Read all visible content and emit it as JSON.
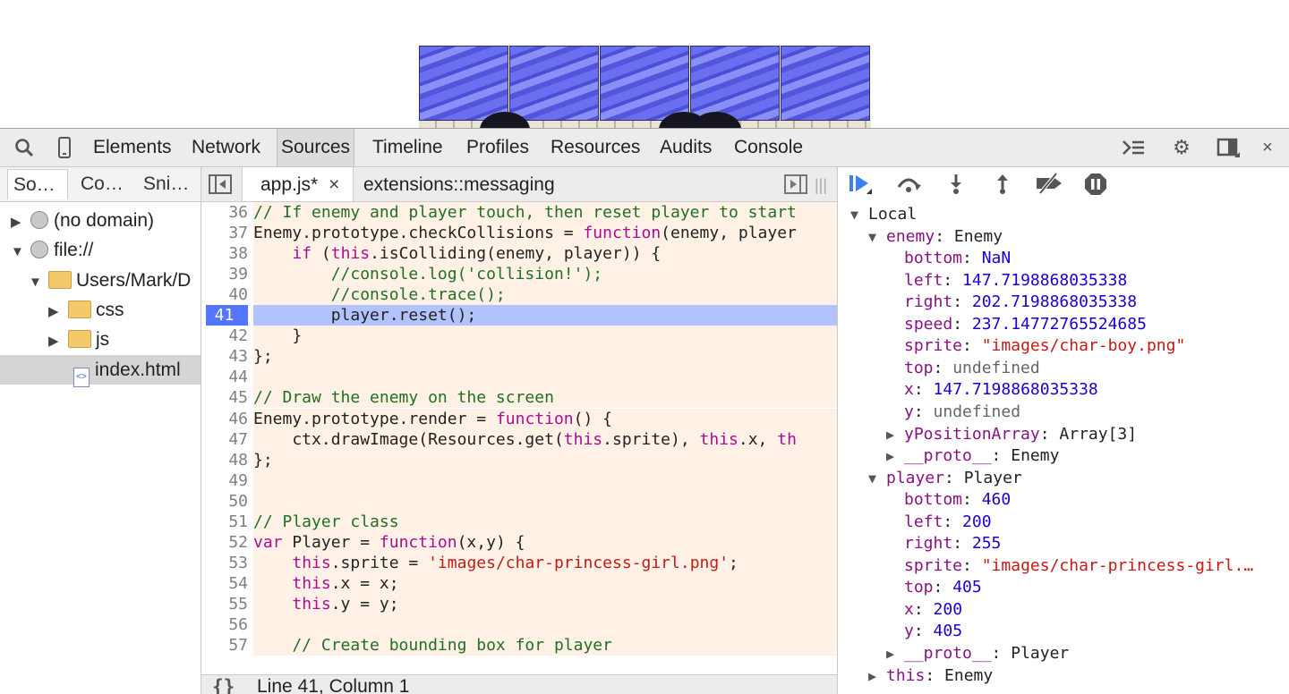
{
  "devtools": {
    "tabs": [
      "Elements",
      "Network",
      "Sources",
      "Timeline",
      "Profiles",
      "Resources",
      "Audits",
      "Console"
    ],
    "active_tab": "Sources",
    "close_glyph": "×"
  },
  "navigator": {
    "tabs": [
      "So…",
      "Co…",
      "Sni…"
    ],
    "tree": [
      {
        "label": "(no domain)",
        "icon": "globe-icon",
        "arrow": "▶"
      },
      {
        "label": "file://",
        "icon": "globe-icon",
        "arrow": "▼"
      },
      {
        "label": "Users/Mark/D",
        "icon": "folder-icon",
        "arrow": "▼"
      },
      {
        "label": "css",
        "icon": "folder-icon",
        "arrow": "▶"
      },
      {
        "label": "js",
        "icon": "folder-icon",
        "arrow": "▶"
      },
      {
        "label": "index.html",
        "icon": "html-file-icon",
        "arrow": ""
      }
    ]
  },
  "editor": {
    "tabs": [
      {
        "label": "app.js*",
        "close": "×"
      },
      {
        "label": "extensions::messaging"
      }
    ],
    "current_line": 41,
    "status": "Line 41, Column 1",
    "format_button": "{}",
    "lines": [
      {
        "n": "36",
        "t": [
          [
            "comment",
            "// If enemy and player touch, then reset player to start"
          ]
        ]
      },
      {
        "n": "37",
        "t": [
          [
            "",
            "Enemy.prototype.checkCollisions = "
          ],
          [
            "kw",
            "function"
          ],
          [
            "",
            "(enemy, player"
          ]
        ]
      },
      {
        "n": "38",
        "t": [
          [
            "",
            "    "
          ],
          [
            "kw",
            "if"
          ],
          [
            "",
            " ("
          ],
          [
            "kw",
            "this"
          ],
          [
            "",
            ".isColliding(enemy, player)) {"
          ]
        ]
      },
      {
        "n": "39",
        "t": [
          [
            "comment",
            "        //console.log('collision!');"
          ]
        ]
      },
      {
        "n": "40",
        "t": [
          [
            "comment",
            "        //console.trace();"
          ]
        ]
      },
      {
        "n": "41",
        "t": [
          [
            "",
            "        player.reset();"
          ]
        ]
      },
      {
        "n": "42",
        "t": [
          [
            "",
            "    }"
          ]
        ]
      },
      {
        "n": "43",
        "t": [
          [
            "",
            "};"
          ]
        ]
      },
      {
        "n": "44",
        "t": [
          [
            "",
            ""
          ]
        ]
      },
      {
        "n": "45",
        "t": [
          [
            "comment",
            "// Draw the enemy on the screen"
          ]
        ]
      },
      {
        "n": "46",
        "t": [
          [
            "",
            "Enemy.prototype.render = "
          ],
          [
            "kw",
            "function"
          ],
          [
            "",
            "() {"
          ]
        ]
      },
      {
        "n": "47",
        "t": [
          [
            "",
            "    ctx.drawImage(Resources.get("
          ],
          [
            "kw",
            "this"
          ],
          [
            "",
            ".sprite), "
          ],
          [
            "kw",
            "this"
          ],
          [
            "",
            ".x, "
          ],
          [
            "kw",
            "th"
          ]
        ]
      },
      {
        "n": "48",
        "t": [
          [
            "",
            "};"
          ]
        ]
      },
      {
        "n": "49",
        "t": [
          [
            "",
            ""
          ]
        ]
      },
      {
        "n": "50",
        "t": [
          [
            "",
            ""
          ]
        ]
      },
      {
        "n": "51",
        "t": [
          [
            "comment",
            "// Player class"
          ]
        ]
      },
      {
        "n": "52",
        "t": [
          [
            "kw",
            "var"
          ],
          [
            "",
            " Player = "
          ],
          [
            "kw",
            "function"
          ],
          [
            "",
            "(x,y) {"
          ]
        ]
      },
      {
        "n": "53",
        "t": [
          [
            "",
            "    "
          ],
          [
            "kw",
            "this"
          ],
          [
            "",
            ".sprite = "
          ],
          [
            "str",
            "'images/char-princess-girl.png'"
          ],
          [
            "",
            ";"
          ]
        ]
      },
      {
        "n": "54",
        "t": [
          [
            "",
            "    "
          ],
          [
            "kw",
            "this"
          ],
          [
            "",
            ".x = x;"
          ]
        ]
      },
      {
        "n": "55",
        "t": [
          [
            "",
            "    "
          ],
          [
            "kw",
            "this"
          ],
          [
            "",
            ".y = y;"
          ]
        ]
      },
      {
        "n": "56",
        "t": [
          [
            "",
            ""
          ]
        ]
      },
      {
        "n": "57",
        "t": [
          [
            "comment",
            "    // Create bounding box for player"
          ]
        ]
      }
    ]
  },
  "scope": {
    "section": "Local",
    "rows": [
      {
        "ind": 0,
        "arrow": "▼",
        "name": "Local",
        "type": "header"
      },
      {
        "ind": 1,
        "arrow": "▼",
        "name": "enemy",
        "val": "Enemy",
        "vt": "obj"
      },
      {
        "ind": 2,
        "name": "bottom",
        "val": "NaN",
        "vt": "num"
      },
      {
        "ind": 2,
        "name": "left",
        "val": "147.7198868035338",
        "vt": "num"
      },
      {
        "ind": 2,
        "name": "right",
        "val": "202.7198868035338",
        "vt": "num"
      },
      {
        "ind": 2,
        "name": "speed",
        "val": "237.14772765524685",
        "vt": "num"
      },
      {
        "ind": 2,
        "name": "sprite",
        "val": "\"images/char-boy.png\"",
        "vt": "str"
      },
      {
        "ind": 2,
        "name": "top",
        "val": "undefined",
        "vt": "undef"
      },
      {
        "ind": 2,
        "name": "x",
        "val": "147.7198868035338",
        "vt": "num"
      },
      {
        "ind": 2,
        "name": "y",
        "val": "undefined",
        "vt": "undef"
      },
      {
        "ind": 2,
        "arrow": "▶",
        "name": "yPositionArray",
        "val": "Array[3]",
        "vt": "obj"
      },
      {
        "ind": 2,
        "arrow": "▶",
        "name": "__proto__",
        "val": "Enemy",
        "vt": "obj"
      },
      {
        "ind": 1,
        "arrow": "▼",
        "name": "player",
        "val": "Player",
        "vt": "obj"
      },
      {
        "ind": 2,
        "name": "bottom",
        "val": "460",
        "vt": "num"
      },
      {
        "ind": 2,
        "name": "left",
        "val": "200",
        "vt": "num"
      },
      {
        "ind": 2,
        "name": "right",
        "val": "255",
        "vt": "num"
      },
      {
        "ind": 2,
        "name": "sprite",
        "val": "\"images/char-princess-girl.…",
        "vt": "str"
      },
      {
        "ind": 2,
        "name": "top",
        "val": "405",
        "vt": "num"
      },
      {
        "ind": 2,
        "name": "x",
        "val": "200",
        "vt": "num"
      },
      {
        "ind": 2,
        "name": "y",
        "val": "405",
        "vt": "num"
      },
      {
        "ind": 2,
        "arrow": "▶",
        "name": "__proto__",
        "val": "Player",
        "vt": "obj"
      },
      {
        "ind": 1,
        "arrow": "▶",
        "name": "this",
        "val": "Enemy",
        "vt": "obj"
      }
    ]
  }
}
